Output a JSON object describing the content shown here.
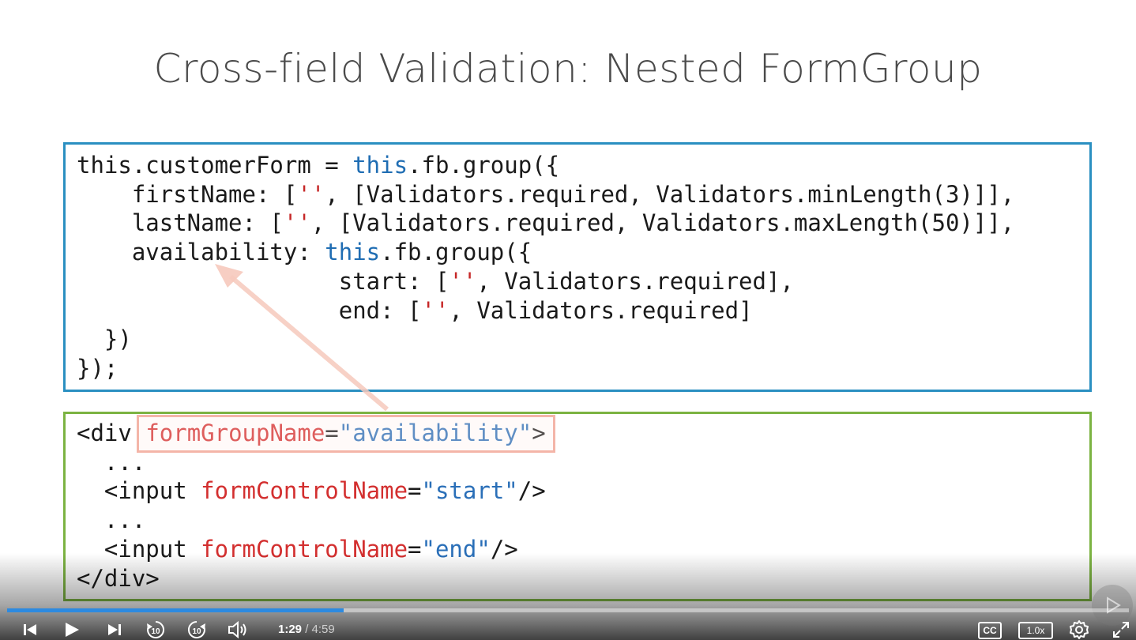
{
  "slide": {
    "title": "Cross-field Validation: Nested FormGroup"
  },
  "ts_code": [
    "this.customerForm = ",
    "this",
    ".fb.group({",
    "    firstName: [",
    "''",
    ", [Validators.required, Validators.minLength(3)]],",
    "    lastName: [",
    "''",
    ", [Validators.required, Validators.maxLength(50)]],",
    "    availability: ",
    "this",
    ".fb.group({",
    "                   start: [",
    "''",
    ", Validators.required],",
    "                   end: [",
    "''",
    ", Validators.required]",
    "  })",
    "});"
  ],
  "html_code": {
    "div_open": "<div ",
    "group_attr": "formGroupName",
    "eq": "=",
    "group_val": "\"availability\"",
    "close_gt": ">",
    "ellipsis": "  ...",
    "input_open": "  <input ",
    "control_attr": "formControlName",
    "start_val": "\"start\"",
    "end_val": "\"end\"",
    "self_close": "/>",
    "div_close": "</div>"
  },
  "player": {
    "current_time": "1:29",
    "separator": " / ",
    "duration": "4:59",
    "progress": 0.3,
    "cc_label": "CC",
    "speed_label": "1.0x",
    "rewind_label": "10",
    "forward_label": "10"
  },
  "colors": {
    "ts_border": "#2a8fc1",
    "html_border": "#7cb342",
    "keyword": "#1f6db3",
    "string": "#c62828",
    "progress": "#2d8ae0"
  },
  "icons": [
    "skip-back-icon",
    "play-icon",
    "skip-forward-icon",
    "rewind-10-icon",
    "forward-10-icon",
    "volume-icon",
    "settings-icon",
    "fullscreen-icon",
    "watermark-play-icon"
  ]
}
